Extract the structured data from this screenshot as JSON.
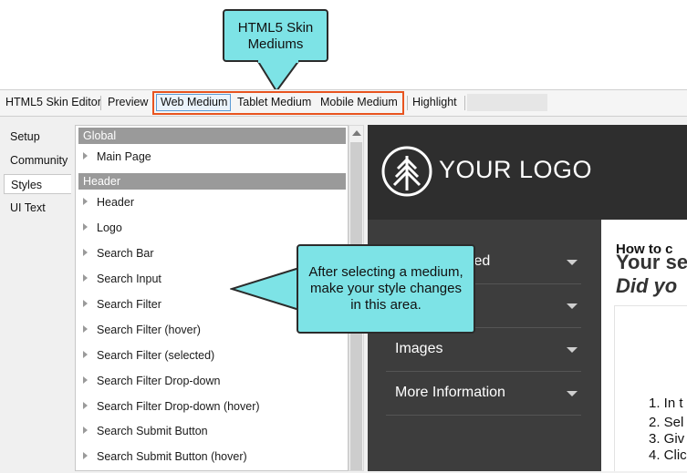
{
  "callouts": {
    "top": [
      "HTML5 Skin",
      "Mediums"
    ],
    "middle": [
      "After selecting a medium,",
      "make your style changes",
      "in this area."
    ]
  },
  "toolbar": {
    "editor_title": "HTML5 Skin Editor",
    "preview": "Preview",
    "web_medium": "Web Medium",
    "tablet_medium": "Tablet Medium",
    "mobile_medium": "Mobile Medium",
    "highlight": "Highlight"
  },
  "tabs": [
    "Setup",
    "Community",
    "Styles",
    "UI Text"
  ],
  "styles_list": {
    "group_global": "Global",
    "global_items": [
      "Main Page"
    ],
    "group_header": "Header",
    "header_items": [
      "Header",
      "Logo",
      "Search Bar",
      "Search Input",
      "Search Filter",
      "Search Filter (hover)",
      "Search Filter (selected)",
      "Search Filter Drop-down",
      "Search Filter Drop-down (hover)",
      "Search Submit Button",
      "Search Submit Button (hover)"
    ]
  },
  "preview": {
    "logo": "YOUR LOGO",
    "nav": [
      "ted",
      "",
      "Images",
      "More Information"
    ],
    "title_line1": "Your se",
    "title_line2": "Did yo",
    "card_title": "How to c",
    "steps": [
      "1. In t",
      "2. Sel",
      "3. Giv",
      "4. Clic"
    ]
  },
  "colors": {
    "callout_fill": "#7de3e6",
    "medium_frame": "#e8541f",
    "preview_header": "#2e2e2e",
    "preview_nav": "#3d3d3d",
    "list_group": "#9a9a9a"
  }
}
